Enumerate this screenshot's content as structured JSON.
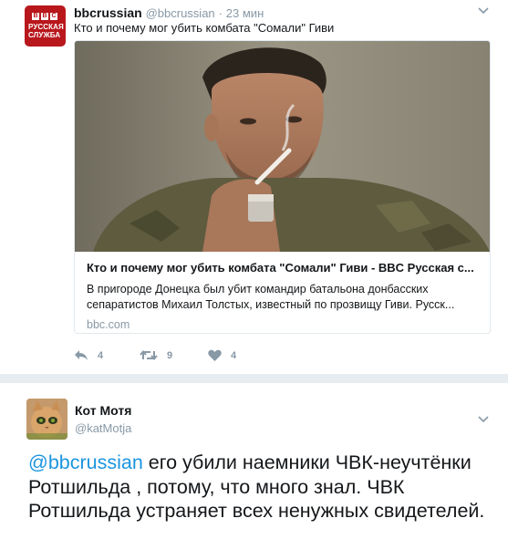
{
  "tweet1": {
    "avatar": {
      "bbc_letters": [
        "B",
        "B",
        "C"
      ],
      "service_lines": [
        "Русская",
        "служба"
      ]
    },
    "name": "bbcrussian",
    "handle": "@bbcrussian",
    "dot": "·",
    "time": "23 мин",
    "text": "Кто и почему мог убить комбата \"Сомали\" Гиви",
    "card": {
      "title": "Кто и почему мог убить комбата \"Сомали\" Гиви - BBC Русская с...",
      "desc_line1": "В пригороде Донецка был убит командир батальона донбасских",
      "desc_line2": "сепаратистов Михаил Толстых, известный по прозвищу Гиви. Русск...",
      "domain": "bbc.com"
    },
    "actions": {
      "reply_count": "4",
      "retweet_count": "9",
      "like_count": "4"
    }
  },
  "tweet2": {
    "name": "Кот Мотя",
    "handle": "@katMotja",
    "mention": "@bbcrussian",
    "text": " его убили наемники ЧВК-неучтёнки Ротшильда , потому, что много знал. ЧВК Ротшильда устраняет всех ненужных свидетелей."
  },
  "colors": {
    "link": "#1b95e0",
    "muted": "#8899a6",
    "bbc_red": "#b8171c",
    "divider": "#e6ecf0"
  },
  "icons": [
    "reply-icon",
    "retweet-icon",
    "like-icon",
    "chevron-down-icon"
  ]
}
